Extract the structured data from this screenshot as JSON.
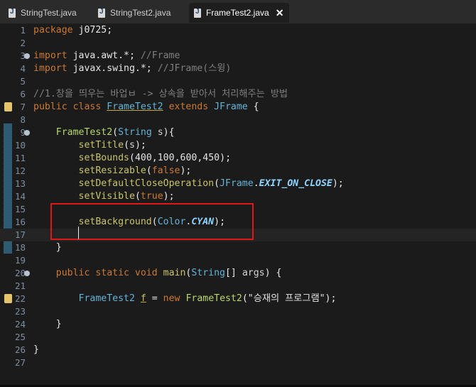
{
  "tabs": [
    {
      "label": "StringTest.java",
      "active": false
    },
    {
      "label": "StringTest2.java",
      "active": false
    },
    {
      "label": "FrameTest2.java",
      "active": true
    }
  ],
  "icons": [
    "java-file-icon",
    "close-icon",
    "fold-icon",
    "warning-icon"
  ],
  "colors": {
    "keyword": "#cc7832",
    "class": "#64b4d8",
    "highlight_box": "#e01818",
    "method": "#c9c46a"
  },
  "lines": [
    {
      "num": "1",
      "parts": [
        [
          "kw",
          "package"
        ],
        [
          "tx",
          " j0725;"
        ]
      ]
    },
    {
      "num": "2",
      "parts": []
    },
    {
      "num": "3",
      "fold": true,
      "parts": [
        [
          "kw",
          "import"
        ],
        [
          "tx",
          " java.awt.*; "
        ],
        [
          "cm",
          "//Frame"
        ]
      ]
    },
    {
      "num": "4",
      "parts": [
        [
          "kw",
          "import"
        ],
        [
          "tx",
          " javax.swing.*; "
        ],
        [
          "cm",
          "//JFrame(스윙)"
        ]
      ]
    },
    {
      "num": "5",
      "parts": []
    },
    {
      "num": "6",
      "parts": [
        [
          "cm",
          "//1.창을 띄우는 바업ㅂ -> 상속을 받아서 처리해주는 방법"
        ]
      ]
    },
    {
      "num": "7",
      "warn": true,
      "parts": [
        [
          "kw",
          "public class "
        ],
        [
          "cls ul",
          "FrameTest2"
        ],
        [
          "kw",
          " extends "
        ],
        [
          "cls",
          "JFrame"
        ],
        [
          "tx",
          " {"
        ]
      ]
    },
    {
      "num": "8",
      "parts": []
    },
    {
      "num": "9",
      "fold": true,
      "parts": [
        [
          "tx",
          "    "
        ],
        [
          "fn",
          "FrameTest2"
        ],
        [
          "tx",
          "("
        ],
        [
          "cls",
          "String"
        ],
        [
          "ps",
          " s"
        ],
        [
          "tx",
          "){"
        ]
      ]
    },
    {
      "num": "10",
      "parts": [
        [
          "tx",
          "        "
        ],
        [
          "mt",
          "setTitle"
        ],
        [
          "tx",
          "("
        ],
        [
          "ps",
          "s"
        ],
        [
          "tx",
          ");"
        ]
      ]
    },
    {
      "num": "11",
      "parts": [
        [
          "tx",
          "        "
        ],
        [
          "mt",
          "setBounds"
        ],
        [
          "tx",
          "("
        ],
        [
          "st",
          "400"
        ],
        [
          "tx",
          ","
        ],
        [
          "st",
          "100"
        ],
        [
          "tx",
          ","
        ],
        [
          "st",
          "600"
        ],
        [
          "tx",
          ","
        ],
        [
          "st",
          "450"
        ],
        [
          "tx",
          ");"
        ]
      ]
    },
    {
      "num": "12",
      "parts": [
        [
          "tx",
          "        "
        ],
        [
          "mt",
          "setResizable"
        ],
        [
          "tx",
          "("
        ],
        [
          "kw",
          "false"
        ],
        [
          "tx",
          ");"
        ]
      ]
    },
    {
      "num": "13",
      "parts": [
        [
          "tx",
          "        "
        ],
        [
          "mt",
          "setDefaultCloseOperation"
        ],
        [
          "tx",
          "("
        ],
        [
          "cls",
          "JFrame"
        ],
        [
          "tx",
          "."
        ],
        [
          "cst",
          "EXIT_ON_CLOSE"
        ],
        [
          "tx",
          ");"
        ]
      ]
    },
    {
      "num": "14",
      "parts": [
        [
          "tx",
          "        "
        ],
        [
          "mt",
          "setVisible"
        ],
        [
          "tx",
          "("
        ],
        [
          "kw",
          "true"
        ],
        [
          "tx",
          ");"
        ]
      ]
    },
    {
      "num": "15",
      "parts": []
    },
    {
      "num": "16",
      "parts": [
        [
          "tx",
          "        "
        ],
        [
          "mt",
          "setBackground"
        ],
        [
          "tx",
          "("
        ],
        [
          "cls",
          "Color"
        ],
        [
          "tx",
          "."
        ],
        [
          "cst",
          "CYAN"
        ],
        [
          "tx",
          ");"
        ]
      ]
    },
    {
      "num": "17",
      "current": true,
      "parts": []
    },
    {
      "num": "18",
      "parts": [
        [
          "tx",
          "    }"
        ]
      ]
    },
    {
      "num": "19",
      "parts": []
    },
    {
      "num": "20",
      "fold": true,
      "parts": [
        [
          "tx",
          "    "
        ],
        [
          "kw",
          "public static void "
        ],
        [
          "mt",
          "main"
        ],
        [
          "tx",
          "("
        ],
        [
          "cls",
          "String"
        ],
        [
          "tx",
          "[] "
        ],
        [
          "ps",
          "args"
        ],
        [
          "tx",
          ") {"
        ]
      ]
    },
    {
      "num": "21",
      "parts": []
    },
    {
      "num": "22",
      "warn": true,
      "parts": [
        [
          "tx",
          "        "
        ],
        [
          "cls",
          "FrameTest2"
        ],
        [
          "tx",
          " "
        ],
        [
          "mt ulr",
          "f"
        ],
        [
          "tx",
          " = "
        ],
        [
          "kw",
          "new "
        ],
        [
          "fn",
          "FrameTest2"
        ],
        [
          "tx",
          "("
        ],
        [
          "st",
          "\"승재의 프로그램\""
        ],
        [
          "tx",
          ");"
        ]
      ]
    },
    {
      "num": "23",
      "parts": []
    },
    {
      "num": "24",
      "parts": [
        [
          "tx",
          "    }"
        ]
      ]
    },
    {
      "num": "25",
      "parts": []
    },
    {
      "num": "26",
      "parts": [
        [
          "tx",
          "}"
        ]
      ]
    },
    {
      "num": "27",
      "parts": []
    }
  ]
}
